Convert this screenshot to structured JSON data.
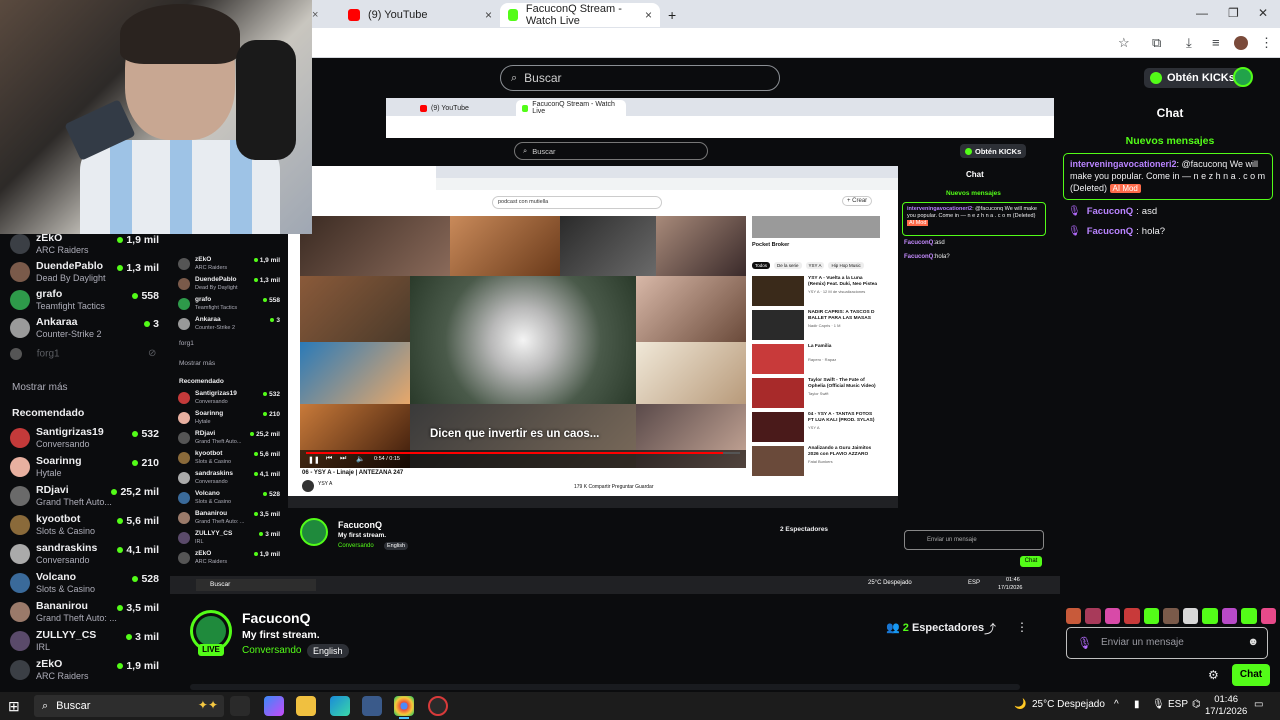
{
  "browser": {
    "tabs": [
      {
        "title": "(9) YouTube",
        "active": false
      },
      {
        "title": "FacuconQ Stream - Watch Live",
        "active": true
      }
    ],
    "new_tab": "+"
  },
  "kick_header": {
    "search_placeholder": "Buscar",
    "kicks_button": "Obtén KICKs"
  },
  "sidebar": {
    "following": [
      {
        "name": "zEkO",
        "category": "ARC Raiders",
        "viewers": "1,9 mil",
        "online": true
      },
      {
        "name": "DuendePablo",
        "category": "Dead By Daylight",
        "viewers": "1,3 mil",
        "online": true
      },
      {
        "name": "grafo",
        "category": "Teamfight Tactics",
        "viewers": "558",
        "online": true
      },
      {
        "name": "Ankaraa",
        "category": "Counter-Strike 2",
        "viewers": "3",
        "online": true
      }
    ],
    "offline": "forg1",
    "show_more": "Mostrar más",
    "recommended_title": "Recomendado",
    "recommended": [
      {
        "name": "Santigrizas19",
        "category": "Conversando",
        "viewers": "532"
      },
      {
        "name": "Soarinng",
        "category": "Hytale",
        "viewers": "210"
      },
      {
        "name": "RDjavi",
        "category": "Grand Theft Auto...",
        "viewers": "25,2 mil"
      },
      {
        "name": "kyootbot",
        "category": "Slots & Casino",
        "viewers": "5,6 mil"
      },
      {
        "name": "sandraskins",
        "category": "Conversando",
        "viewers": "4,1 mil"
      },
      {
        "name": "Volcano",
        "category": "Slots & Casino",
        "viewers": "528"
      },
      {
        "name": "Bananirou",
        "category": "Grand Theft Auto: ...",
        "viewers": "3,5 mil"
      },
      {
        "name": "ZULLYY_CS",
        "category": "IRL",
        "viewers": "3 mil"
      },
      {
        "name": "zEkO",
        "category": "ARC Raiders",
        "viewers": "1,9 mil"
      }
    ]
  },
  "nested": {
    "tabs": [
      "(9) YouTube",
      "FacuconQ Stream - Watch Live"
    ],
    "search_placeholder": "Buscar",
    "kicks_button": "Obtén KICKs",
    "show_more": "Mostrar más",
    "recommended_title": "Recomendado",
    "youtube": {
      "search_text": "podcast con mutiella",
      "caption": "Dicen que invertir es un caos...",
      "time": "0:54 / 0:15",
      "video_title": "06 - YSY A - Linaje | ANTEZANA 247",
      "channel": "YSY A",
      "actions": "179 K   Compartir   Preguntar   Guardar",
      "sidebar_channel": "Pocket Broker",
      "chips": [
        "Todos",
        "De la serie",
        "YSY A",
        "Hip Hop Music"
      ],
      "recs": [
        {
          "title": "YSY A - Vuelta a la Luna (Remix) Feat. Duki, Neo Pistea",
          "sub": "YSY A · 12 M de visualizaciones"
        },
        {
          "title": "NADIR CAPRIS: A TASCOS D BALLET PARA LAS MASAS",
          "sub": "Nadir Capris · 1 M"
        },
        {
          "title": "La Familia",
          "sub": "Rapero · Rapaz"
        },
        {
          "title": "Taylor Swift - The Fate of Ophelia (Official Music Video)",
          "sub": "Taylor Swift"
        },
        {
          "title": "04 - YSY A - TANTAS FOTOS FT LUA KALI (PROD. SYLAS)",
          "sub": "YSY A"
        },
        {
          "title": "Analizando a Guru Jaimitos 2026 con FLAVIO AZZARO",
          "sub": "Fatal Bunkers"
        }
      ]
    },
    "streamer": {
      "name": "FacuconQ",
      "title": "My first stream.",
      "category": "Conversando",
      "language": "English",
      "viewers": "2 Espectadores"
    },
    "chat": {
      "title": "Chat",
      "new_messages": "Nuevos mensajes",
      "pinned_user": "interveningavocationeri2",
      "pinned_text": ": @facuconq We will make you popular. Come in — n e z h n a . c o m (Deleted)",
      "ai_tag": "AI Mod",
      "messages": [
        {
          "user": "FacuconQ",
          "text": "asd"
        },
        {
          "user": "FacuconQ",
          "text": "hola?"
        }
      ],
      "input_placeholder": "Enviar un mensaje",
      "send": "Chat"
    },
    "taskbar": {
      "search": "Buscar",
      "weather": "25°C Despejado",
      "lang": "ESP",
      "time": "01:46",
      "date": "17/1/2026"
    }
  },
  "streamer": {
    "name": "FacuconQ",
    "live": "LIVE",
    "title": "My first stream.",
    "category": "Conversando",
    "language": "English",
    "viewers_count": "2",
    "viewers_label": "Espectadores"
  },
  "chat": {
    "title": "Chat",
    "new_messages": "Nuevos mensajes",
    "pinned_user": "interveningavocationeri2",
    "pinned_text": ": @facuconq We will make you popular. Come in — n e z h n a . c o m (Deleted)",
    "ai_tag": "AI Mod",
    "messages": [
      {
        "user": "FacuconQ",
        "text": "asd"
      },
      {
        "user": "FacuconQ",
        "text": "hola?"
      }
    ],
    "input_placeholder": "Enviar un mensaje",
    "send_label": "Chat"
  },
  "taskbar": {
    "search": "Buscar",
    "weather": "25°C Despejado",
    "lang": "ESP",
    "time": "01:46",
    "date": "17/1/2026"
  },
  "colors": {
    "kick_green": "#53fc18",
    "user_purple": "#b984ff",
    "background": "#0b0c0e"
  }
}
